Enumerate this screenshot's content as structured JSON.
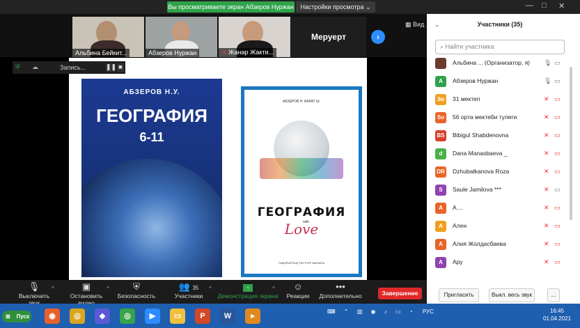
{
  "top_bar": {
    "share_notice": "Вы просматриваете экран Абзеров Нуржан",
    "view_options": "Настройки просмотра ⌄",
    "minimize": "—",
    "maximize": "□",
    "close": "✕"
  },
  "video_tiles": [
    {
      "name": "Альбина Бейкит..."
    },
    {
      "name": "Абзеров Нуржан"
    },
    {
      "name": "Жанар Жакти..."
    }
  ],
  "text_tile": "Меруерт",
  "view_button": "Вид",
  "recording_label": "Запись...",
  "book_left": {
    "author": "АБЗЕРОВ Н.У.",
    "title": "ГЕОГРАФИЯ",
    "grade": "6-11"
  },
  "book_right": {
    "authors": "АБЗЕРОВ Н.  БАРАТ Ш.",
    "title": "ГЕОГРАФИЯ",
    "with": "with",
    "love": "Love",
    "subtitle": "ТАҚЫРЫПТЫҚ ТЕСТТЕР ЖИНАҒЫ"
  },
  "participants": {
    "title": "Участники (35)",
    "search_placeholder": "Найти участника",
    "list": [
      {
        "initials": "",
        "name": "Альбина ... (Организатор, я)",
        "color": "#6b3b2e"
      },
      {
        "initials": "A",
        "name": "Абзеров Нуржан",
        "color": "#2fa24a"
      },
      {
        "initials": "3м",
        "name": "31 мектеп",
        "color": "#f0a020"
      },
      {
        "initials": "So",
        "name": "56 орта мектеби тулеги",
        "color": "#e8642a"
      },
      {
        "initials": "BS",
        "name": "Bibigul Shabdenovna",
        "color": "#d9402b"
      },
      {
        "initials": "d",
        "name": "Dana Manasbaeva _",
        "color": "#4ab04a"
      },
      {
        "initials": "DR",
        "name": "Dzhubatkanova Roza",
        "color": "#e8642a"
      },
      {
        "initials": "S",
        "name": "Saule Jamilova ***",
        "color": "#8e44ad"
      },
      {
        "initials": "A",
        "name": "A....",
        "color": "#e8642a"
      },
      {
        "initials": "A",
        "name": "Ален",
        "color": "#f0a020"
      },
      {
        "initials": "A",
        "name": "Алия Жолдасбаева",
        "color": "#e8642a"
      },
      {
        "initials": "A",
        "name": "Ару",
        "color": "#8e44ad"
      }
    ],
    "invite_button": "Пригласить",
    "mute_all_button": "Выкл. весь звук",
    "more_button": "..."
  },
  "toolbar": {
    "mute": "Выключить звук",
    "stop_video": "Остановить видео",
    "security": "Безопасность",
    "participants": "Участники",
    "participants_count": "35",
    "share_screen": "Демонстрация экрана",
    "reactions": "Реакции",
    "more": "Дополнительно",
    "end": "Завершение"
  },
  "taskbar": {
    "start": "Пуск",
    "lang": "РУС",
    "time": "16:45",
    "date": "01.04.2021"
  }
}
